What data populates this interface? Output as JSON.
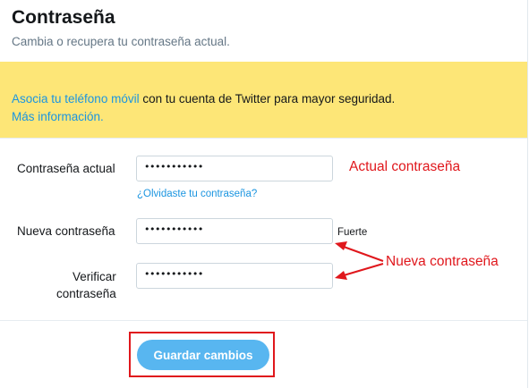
{
  "header": {
    "title": "Contraseña",
    "subtitle": "Cambia o recupera tu contraseña actual."
  },
  "banner": {
    "link_phone": "Asocia tu teléfono móvil",
    "text": " con tu cuenta de Twitter para mayor seguridad.",
    "link_more": "Más información."
  },
  "form": {
    "current_label": "Contraseña actual",
    "current_value": "•••••••••••",
    "forgot_link": "¿Olvidaste tu contraseña?",
    "new_label": "Nueva contraseña",
    "new_value": "•••••••••••",
    "strength": "Fuerte",
    "verify_label_line1": "Verificar",
    "verify_label_line2": "contraseña",
    "verify_value": "•••••••••••"
  },
  "annotations": {
    "current": "Actual contraseña",
    "new": "Nueva contraseña",
    "color": "#e0171c"
  },
  "footer": {
    "save_label": "Guardar cambios"
  },
  "colors": {
    "banner_bg": "#fde677",
    "link": "#1b95e0",
    "button_bg": "#58b6f0"
  }
}
